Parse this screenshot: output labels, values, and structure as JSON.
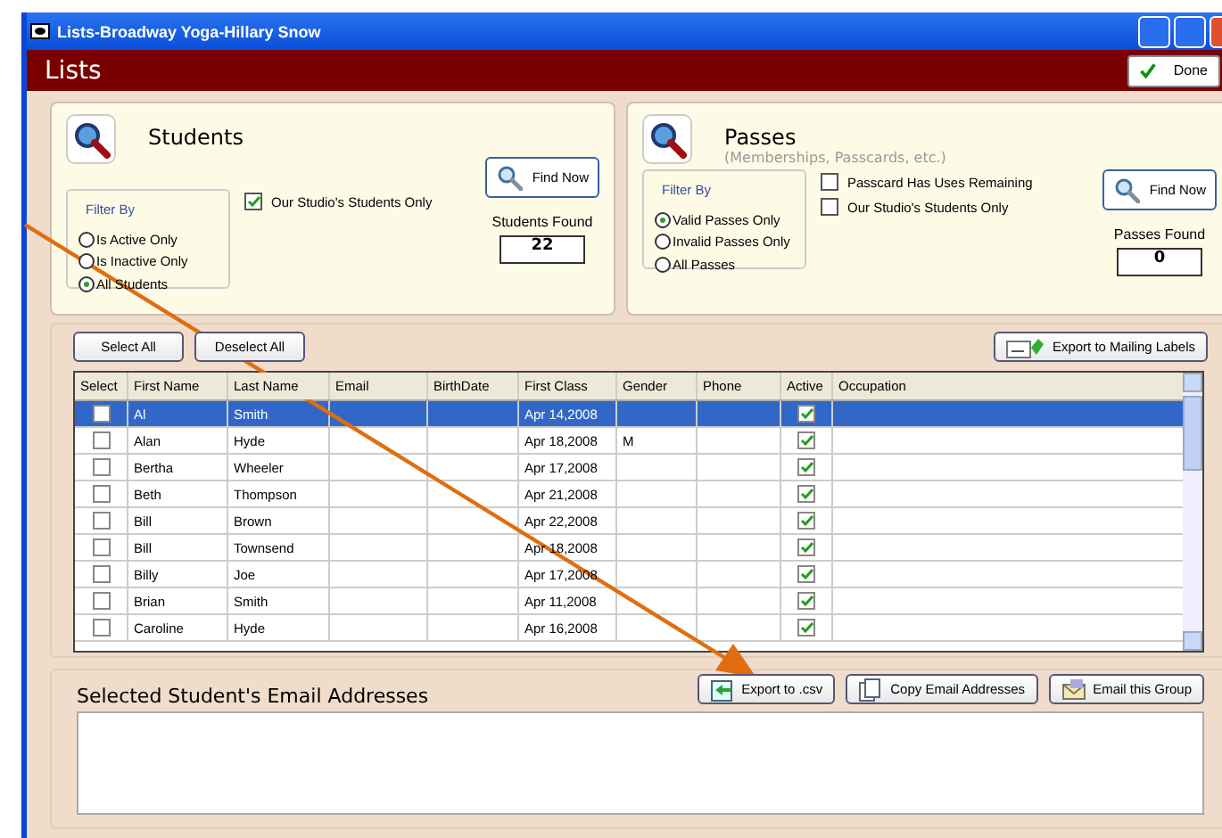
{
  "window": {
    "title": "Lists-Broadway Yoga-Hillary Snow"
  },
  "header": {
    "title": "Lists",
    "done_button": "Done"
  },
  "students_panel": {
    "title": "Students",
    "filter_label": "Filter By",
    "radios": [
      {
        "label": "Is Active Only",
        "selected": false
      },
      {
        "label": "Is Inactive Only",
        "selected": false
      },
      {
        "label": "All Students",
        "selected": true
      }
    ],
    "checkboxes": [
      {
        "label": "Our Studio's Students Only",
        "checked": true
      }
    ],
    "find_button": "Find Now",
    "found_label": "Students Found",
    "found_value": "22"
  },
  "passes_panel": {
    "title": "Passes",
    "subtitle": "(Memberships, Passcards, etc.)",
    "filter_label": "Filter By",
    "radios": [
      {
        "label": "Valid Passes Only",
        "selected": true
      },
      {
        "label": "Invalid Passes Only",
        "selected": false
      },
      {
        "label": "All Passes",
        "selected": false
      }
    ],
    "checkboxes": [
      {
        "label": "Passcard Has Uses Remaining",
        "checked": false
      },
      {
        "label": "Our Studio's Students Only",
        "checked": false
      }
    ],
    "find_button": "Find Now",
    "found_label": "Passes Found",
    "found_value": "0"
  },
  "toolbar": {
    "select_all": "Select All",
    "deselect_all": "Deselect All",
    "export_labels": "Export to Mailing Labels"
  },
  "table": {
    "columns": [
      "Select",
      "First Name",
      "Last Name",
      "Email",
      "BirthDate",
      "First Class",
      "Gender",
      "Phone",
      "Active",
      "Occupation"
    ],
    "rows": [
      {
        "selected": true,
        "checked": false,
        "first_name": "Al",
        "last_name": "Smith",
        "first_class": "Apr 14,2008",
        "gender": "",
        "active": true
      },
      {
        "selected": false,
        "checked": false,
        "first_name": "Alan",
        "last_name": "Hyde",
        "first_class": "Apr 18,2008",
        "gender": "M",
        "active": true
      },
      {
        "selected": false,
        "checked": false,
        "first_name": "Bertha",
        "last_name": "Wheeler",
        "first_class": "Apr 17,2008",
        "gender": "",
        "active": true
      },
      {
        "selected": false,
        "checked": false,
        "first_name": "Beth",
        "last_name": "Thompson",
        "first_class": "Apr 21,2008",
        "gender": "",
        "active": true
      },
      {
        "selected": false,
        "checked": false,
        "first_name": "Bill",
        "last_name": "Brown",
        "first_class": "Apr 22,2008",
        "gender": "",
        "active": true
      },
      {
        "selected": false,
        "checked": false,
        "first_name": "Bill",
        "last_name": "Townsend",
        "first_class": "Apr 18,2008",
        "gender": "",
        "active": true
      },
      {
        "selected": false,
        "checked": false,
        "first_name": "Billy",
        "last_name": "Joe",
        "first_class": "Apr 17,2008",
        "gender": "",
        "active": true
      },
      {
        "selected": false,
        "checked": false,
        "first_name": "Brian",
        "last_name": "Smith",
        "first_class": "Apr 11,2008",
        "gender": "",
        "active": true
      },
      {
        "selected": false,
        "checked": false,
        "first_name": "Caroline",
        "last_name": "Hyde",
        "first_class": "Apr 16,2008",
        "gender": "",
        "active": true
      }
    ]
  },
  "email_section": {
    "title": "Selected Student's Email Addresses",
    "buttons": [
      {
        "kind": "export",
        "label": "Export to .csv"
      },
      {
        "kind": "copy",
        "label": "Copy Email Addresses"
      },
      {
        "kind": "email",
        "label": "Email this Group"
      }
    ]
  }
}
